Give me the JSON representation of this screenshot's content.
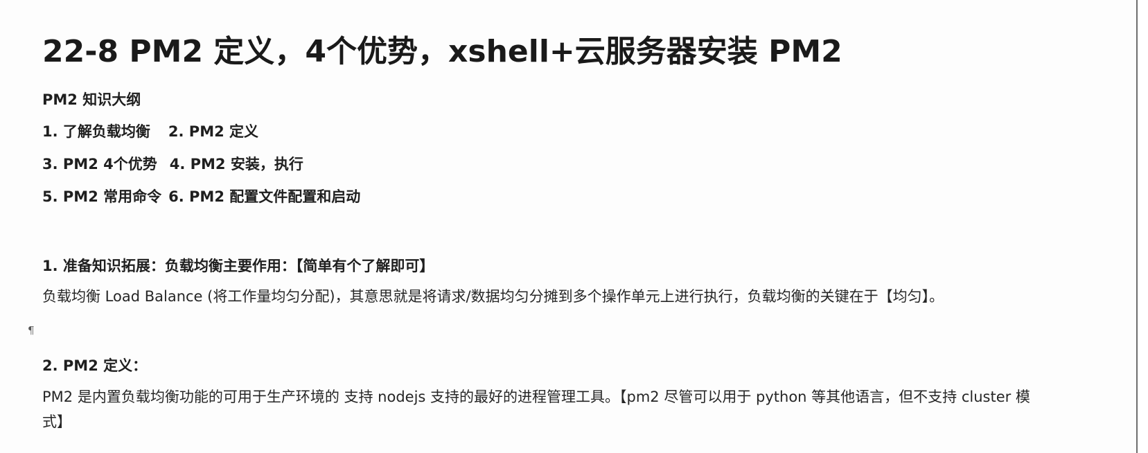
{
  "title": "22-8 PM2 定义，4个优势，xshell+云服务器安装 PM2",
  "outline": {
    "heading": "PM2  知识大纲",
    "rows": [
      [
        "1. 了解负载均衡",
        "2. PM2 定义"
      ],
      [
        "3. PM2 4个优势",
        "4. PM2 安装，执行"
      ],
      [
        "5. PM2 常用命令",
        "6. PM2 配置文件配置和启动"
      ]
    ]
  },
  "section1": {
    "heading": "1. 准备知识拓展：负载均衡主要作用：【简单有个了解即可】",
    "body": "负载均衡 Load Balance (将工作量均匀分配)，其意思就是将请求/数据均匀分摊到多个操作单元上进行执行，负载均衡的关键在于【均匀】。"
  },
  "pilcrow": "¶",
  "section2": {
    "heading": "2. PM2 定义：",
    "body_line1": "PM2 是内置负载均衡功能的可用于生产环境的 支持 nodejs 支持的最好的进程管理工具。【pm2 尽管可以用于 python 等其他语言，但不支持 cluster 模",
    "body_line2": "式】"
  }
}
